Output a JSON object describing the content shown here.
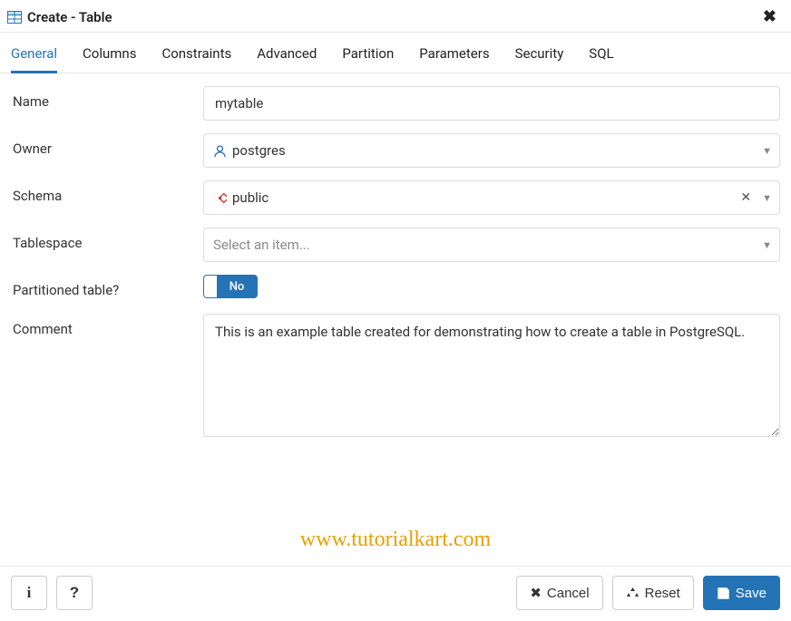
{
  "title": "Create - Table",
  "tabs": [
    {
      "label": "General"
    },
    {
      "label": "Columns"
    },
    {
      "label": "Constraints"
    },
    {
      "label": "Advanced"
    },
    {
      "label": "Partition"
    },
    {
      "label": "Parameters"
    },
    {
      "label": "Security"
    },
    {
      "label": "SQL"
    }
  ],
  "form": {
    "name_label": "Name",
    "name_value": "mytable",
    "owner_label": "Owner",
    "owner_value": "postgres",
    "schema_label": "Schema",
    "schema_value": "public",
    "tablespace_label": "Tablespace",
    "tablespace_placeholder": "Select an item...",
    "partitioned_label": "Partitioned table?",
    "partitioned_toggle": "No",
    "comment_label": "Comment",
    "comment_value": "This is an example table created for demonstrating how to create a table in PostgreSQL."
  },
  "footer": {
    "info_label": "i",
    "help_label": "?",
    "cancel_label": "Cancel",
    "reset_label": "Reset",
    "save_label": "Save"
  },
  "watermark": "www.tutorialkart.com"
}
